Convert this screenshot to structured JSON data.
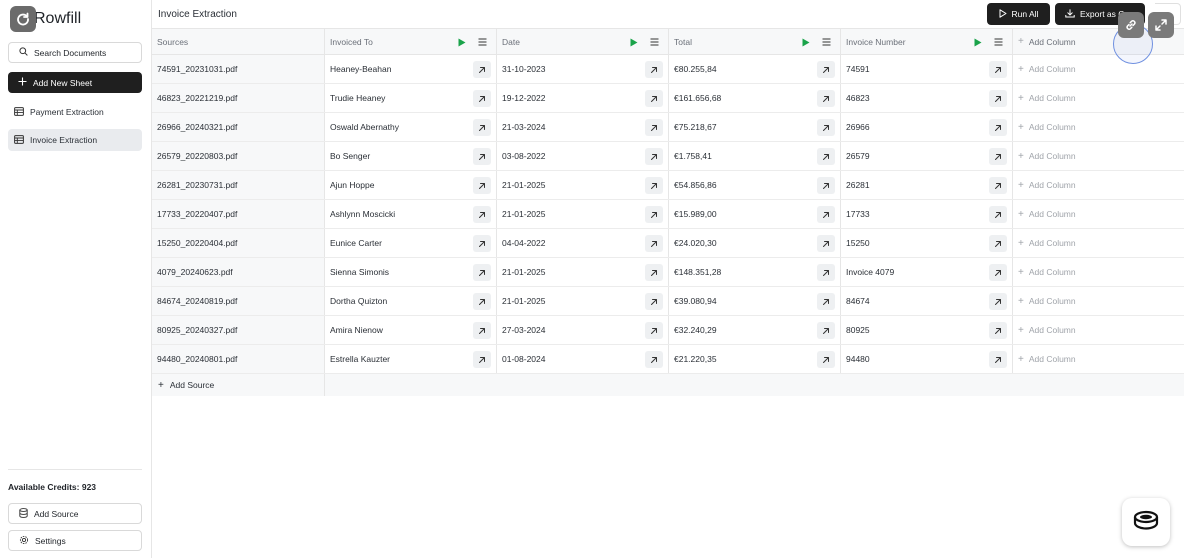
{
  "app": {
    "name": "Rowfill"
  },
  "sidebar": {
    "search_label": "Search Documents",
    "add_sheet_label": "Add New Sheet",
    "items": [
      {
        "label": "Payment Extraction"
      },
      {
        "label": "Invoice Extraction"
      }
    ],
    "credits_label": "Available Credits: 923",
    "add_source_label": "Add Source",
    "settings_label": "Settings"
  },
  "header": {
    "title": "Invoice Extraction",
    "run_all_label": "Run All",
    "export_label": "Export as C"
  },
  "table": {
    "columns": [
      "Sources",
      "Invoiced To",
      "Date",
      "Total",
      "Invoice Number",
      "Add Column"
    ],
    "add_column_label": "Add Column",
    "add_source_label": "Add Source",
    "rows": [
      [
        "74591_20231031.pdf",
        "Heaney-Beahan",
        "31-10-2023",
        "€80.255,84",
        "74591"
      ],
      [
        "46823_20221219.pdf",
        "Trudie Heaney",
        "19-12-2022",
        "€161.656,68",
        "46823"
      ],
      [
        "26966_20240321.pdf",
        "Oswald Abernathy",
        "21-03-2024",
        "€75.218,67",
        "26966"
      ],
      [
        "26579_20220803.pdf",
        "Bo Senger",
        "03-08-2022",
        "€1.758,41",
        "26579"
      ],
      [
        "26281_20230731.pdf",
        "Ajun Hoppe",
        "21-01-2025",
        "€54.856,86",
        "26281"
      ],
      [
        "17733_20220407.pdf",
        "Ashlynn Moscicki",
        "21-01-2025",
        "€15.989,00",
        "17733"
      ],
      [
        "15250_20220404.pdf",
        "Eunice Carter",
        "04-04-2022",
        "€24.020,30",
        "15250"
      ],
      [
        "4079_20240623.pdf",
        "Sienna Simonis",
        "21-01-2025",
        "€148.351,28",
        "Invoice 4079"
      ],
      [
        "84674_20240819.pdf",
        "Dortha Quizton",
        "21-01-2025",
        "€39.080,94",
        "84674"
      ],
      [
        "80925_20240327.pdf",
        "Amira Nienow",
        "27-03-2024",
        "€32.240,29",
        "80925"
      ],
      [
        "94480_20240801.pdf",
        "Estrella Kauzter",
        "01-08-2024",
        "€21.220,35",
        "94480"
      ]
    ]
  },
  "colors": {
    "accent_dark": "#1f1f1f",
    "play_green": "#1aa34a",
    "cursor_ring": "#6e8fe0"
  }
}
